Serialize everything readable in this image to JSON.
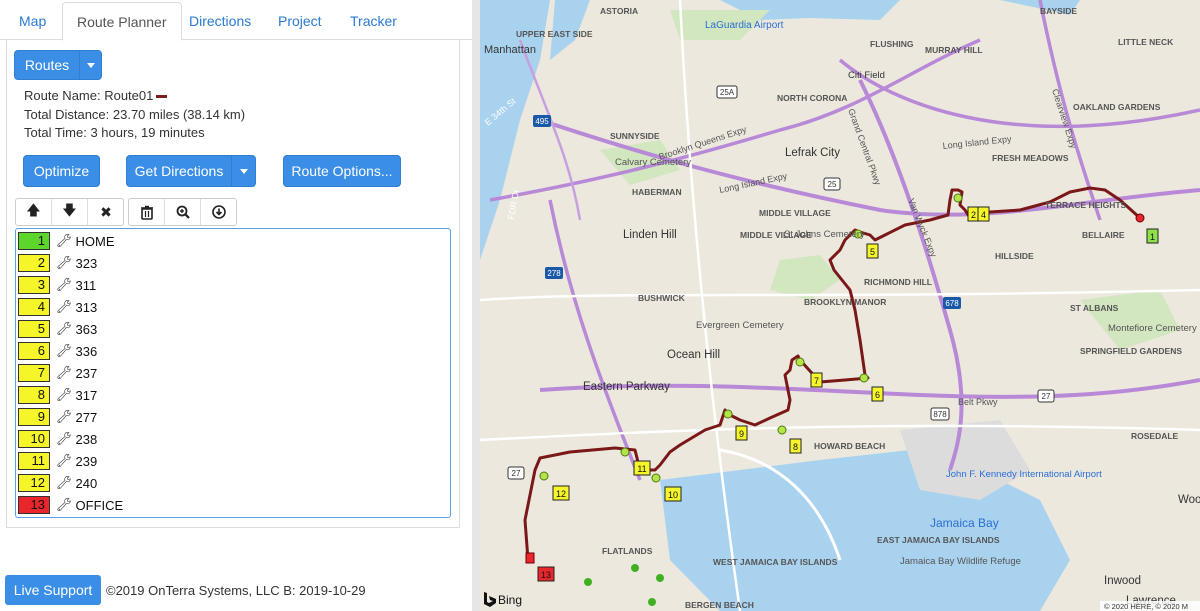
{
  "tabs": [
    {
      "label": "Map"
    },
    {
      "label": "Route Planner"
    },
    {
      "label": "Directions"
    },
    {
      "label": "Project"
    },
    {
      "label": "Tracker"
    }
  ],
  "routes_button": "Routes",
  "route_info": {
    "name": "Route Name: Route01",
    "distance": "Total Distance: 23.70 miles (38.14 km)",
    "time": "Total Time: 3 hours, 19 minutes"
  },
  "buttons": {
    "optimize": "Optimize",
    "get_directions": "Get Directions",
    "route_options": "Route Options..."
  },
  "stops": [
    {
      "num": "1",
      "label": "HOME",
      "color": "#5dd62c"
    },
    {
      "num": "2",
      "label": "323",
      "color": "#f5f52a"
    },
    {
      "num": "3",
      "label": "311",
      "color": "#f5f52a"
    },
    {
      "num": "4",
      "label": "313",
      "color": "#f5f52a"
    },
    {
      "num": "5",
      "label": "363",
      "color": "#f5f52a"
    },
    {
      "num": "6",
      "label": "336",
      "color": "#f5f52a"
    },
    {
      "num": "7",
      "label": "237",
      "color": "#f5f52a"
    },
    {
      "num": "8",
      "label": "317",
      "color": "#f5f52a"
    },
    {
      "num": "9",
      "label": "277",
      "color": "#f5f52a"
    },
    {
      "num": "10",
      "label": "238",
      "color": "#f5f52a"
    },
    {
      "num": "11",
      "label": "239",
      "color": "#f5f52a"
    },
    {
      "num": "12",
      "label": "240",
      "color": "#f5f52a"
    },
    {
      "num": "13",
      "label": "OFFICE",
      "color": "#e8262b"
    }
  ],
  "live_support": "Live Support",
  "footer": "©2019 OnTerra Systems, LLC B: 2019-10-29",
  "map": {
    "route_color": "#7a1818",
    "labels": {
      "manhattan": "Manhattan",
      "upper_east_side": "UPPER EAST SIDE",
      "astoria": "ASTORIA",
      "laguardia": "LaGuardia Airport",
      "bayside": "BAYSIDE",
      "flushing": "FLUSHING",
      "murray_hill": "MURRAY HILL",
      "little_neck": "LITTLE NECK",
      "citi_field": "Citi Field",
      "north_corona": "NORTH CORONA",
      "oakland_gardens": "OAKLAND GARDENS",
      "sunnyside": "SUNNYSIDE",
      "calvary": "Calvary Cemetery",
      "lefrak": "Lefrak City",
      "fresh_meadows": "FRESH MEADOWS",
      "haberman": "HABERMAN",
      "terrace_heights": "TERRACE HEIGHTS",
      "middle_village": "MIDDLE VILLAGE",
      "middle_village2": "MIDDLE VILLAGE",
      "st_johns": "St Johns Cemetery",
      "linden_hill": "Linden Hill",
      "bellaire": "BELLAIRE",
      "hillside": "HILLSIDE",
      "richmond_hill": "RICHMOND HILL",
      "bushwick": "BUSHWICK",
      "brooklyn_manor": "BROOKLYN MANOR",
      "st_albans": "ST ALBANS",
      "evergreen": "Evergreen Cemetery",
      "montefiore": "Montefiore Cemetery",
      "ocean_hill": "Ocean Hill",
      "springfield": "SPRINGFIELD GARDENS",
      "eastern_parkway": "Eastern Parkway",
      "howard_beach": "HOWARD BEACH",
      "rosedale": "ROSEDALE",
      "jfk": "John F. Kennedy International Airport",
      "jamaica_bay": "Jamaica Bay",
      "flatlands": "FLATLANDS",
      "east_jamaica": "EAST JAMAICA BAY ISLANDS",
      "west_jamaica": "WEST JAMAICA BAY ISLANDS",
      "jb_wildlife": "Jamaica Bay Wildlife Refuge",
      "inwood": "Inwood",
      "lawrence": "Lawrence",
      "woo": "Woo",
      "bergen": "BERGEN BEACH",
      "belt_pkwy": "Belt Pkwy",
      "brooklyn_queens": "Brooklyn Queens Expy",
      "lie": "Long Island Expy",
      "lie2": "Long Island Expy",
      "van_wyck": "Van Wyck Expy",
      "grand_central": "Grand Central Pkwy",
      "e34": "E 34th St",
      "fdr": "FDR Dr",
      "clearview": "Clearview Expy",
      "bing": "Bing",
      "copyright": "© 2020 HERE, © 2020 M"
    },
    "shields": [
      "495",
      "25A",
      "25",
      "278",
      "678",
      "878",
      "27",
      "27"
    ],
    "markers": [
      "1",
      "2",
      "4",
      "5",
      "6",
      "7",
      "8",
      "9",
      "10",
      "11",
      "12",
      "13"
    ]
  }
}
